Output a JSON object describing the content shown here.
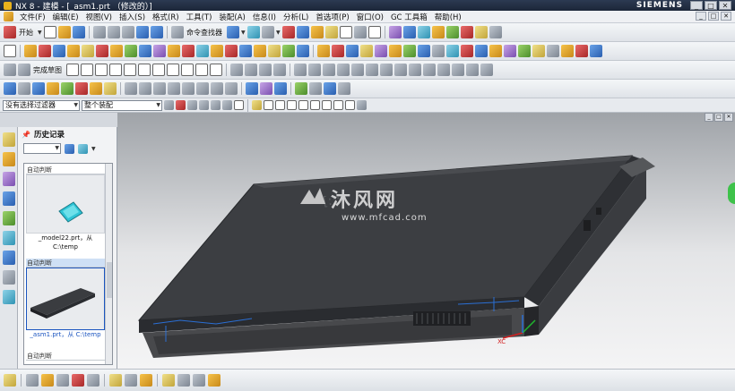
{
  "window": {
    "title": "NX 8 - 建模 - [_asm1.prt （修改的）]",
    "brand": "SIEMENS",
    "controls": [
      "_",
      "□",
      "✕"
    ]
  },
  "menubar": {
    "items": [
      "文件(F)",
      "编辑(E)",
      "视图(V)",
      "插入(S)",
      "格式(R)",
      "工具(T)",
      "装配(A)",
      "信息(I)",
      "分析(L)",
      "首选项(P)",
      "窗口(O)",
      "GC 工具箱",
      "帮助(H)"
    ],
    "mdi_controls": [
      "_",
      "□",
      "✕"
    ]
  },
  "toolbar1": {
    "start_label": "开始",
    "command_finder_label": "命令查找器"
  },
  "toolbar3": {
    "sketch_label": "完成草图"
  },
  "selection_bar": {
    "filter_value": "没有选择过滤器",
    "scope_value": "整个装配"
  },
  "navigator": {
    "title": "历史记录",
    "entries": [
      {
        "tag": "自动判断",
        "caption_line1": "_model22.prt，从",
        "caption_line2": "C:\\temp",
        "selected": false
      },
      {
        "tag": "自动判断",
        "caption_line1": "_asm1.prt，从 C:\\temp",
        "caption_line2": "",
        "selected": true
      },
      {
        "tag": "自动判断",
        "caption_line1": "",
        "caption_line2": "",
        "selected": false
      }
    ]
  },
  "viewport": {
    "watermark_text": "沐风网",
    "watermark_url": "www.mfcad.com",
    "axis_x_label": "XC",
    "model_label": "[:::"
  },
  "colors": {
    "title_bg": "#1c2638",
    "selection_blue": "#1b55c0",
    "model_dark": "#3a3c40",
    "status_green": "#3ec24a"
  }
}
